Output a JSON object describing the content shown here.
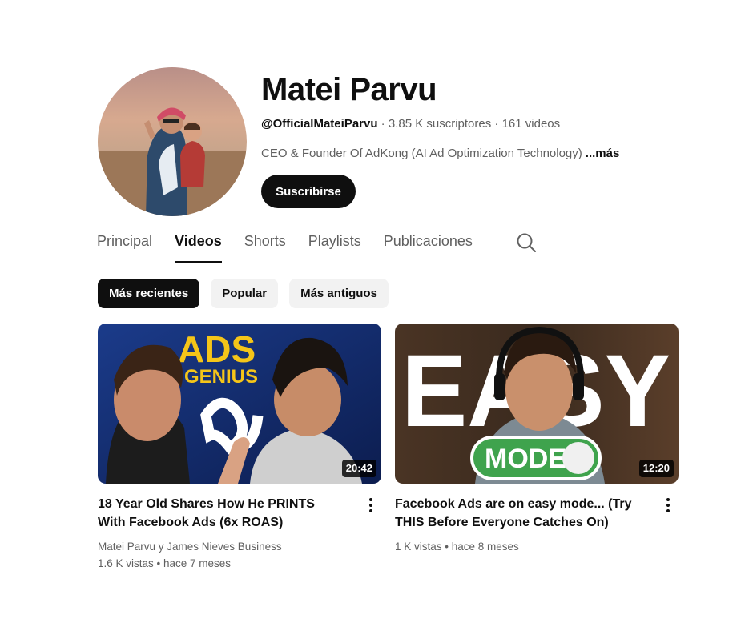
{
  "channel": {
    "name": "Matei Parvu",
    "handle": "@OfficialMateiParvu",
    "stats": " · 3.85 K suscriptores · 161 videos",
    "description": "CEO & Founder Of AdKong (AI Ad Optimization Technology)",
    "more_label": "...más",
    "subscribe_label": "Suscribirse"
  },
  "tabs": [
    {
      "label": "Principal",
      "active": false
    },
    {
      "label": "Videos",
      "active": true
    },
    {
      "label": "Shorts",
      "active": false
    },
    {
      "label": "Playlists",
      "active": false
    },
    {
      "label": "Publicaciones",
      "active": false
    }
  ],
  "chips": [
    {
      "label": "Más recientes",
      "active": true
    },
    {
      "label": "Popular",
      "active": false
    },
    {
      "label": "Más antiguos",
      "active": false
    }
  ],
  "videos": [
    {
      "title": "18 Year Old Shares How He PRINTS With Facebook Ads (6x ROAS)",
      "duration": "20:42",
      "channel": "Matei Parvu y James Nieves Business",
      "stats": "1.6 K vistas • hace 7 meses",
      "thumb_text_1": "ADS",
      "thumb_text_2": "GENIUS"
    },
    {
      "title": "Facebook Ads are on easy mode... (Try THIS Before Everyone Catches On)",
      "duration": "12:20",
      "stats": "1 K vistas • hace 8 meses",
      "thumb_text_1": "EASY",
      "thumb_text_2": "MODE"
    }
  ],
  "icons": {
    "search": "search-icon",
    "more": "more-vert-icon"
  },
  "colors": {
    "primary": "#0f0f0f",
    "secondary": "#606060",
    "chip_bg": "#f2f2f2",
    "ads_yellow": "#f5c518",
    "mode_green": "#3fa34d"
  }
}
